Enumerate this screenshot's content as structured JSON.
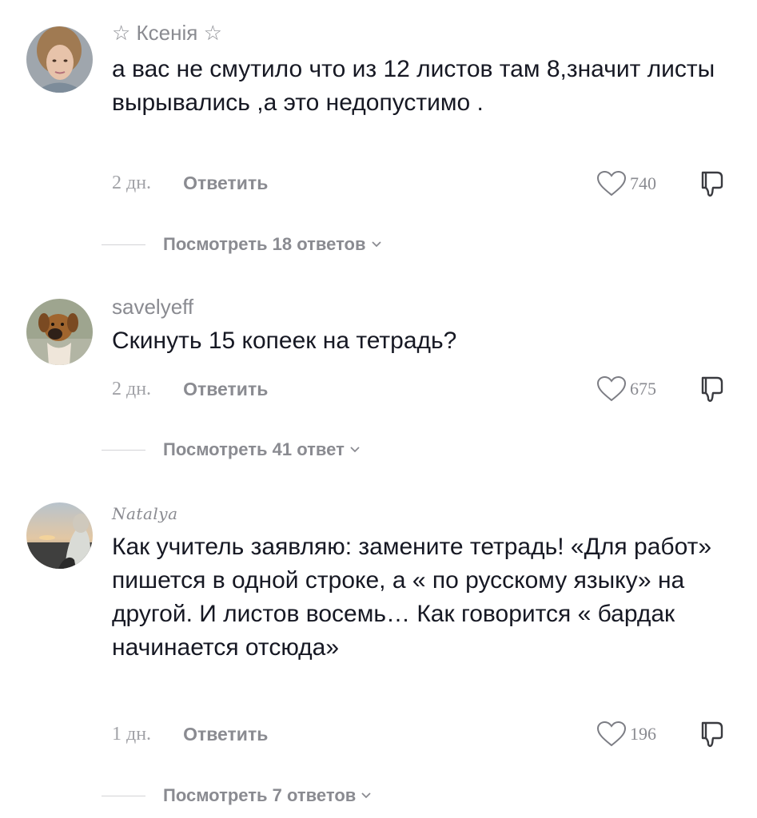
{
  "comments": [
    {
      "username": "☆ Ксенія ☆",
      "text": "а вас не смутило что из 12 листов там 8,значит листы вырывались ,а это недопустимо .",
      "age": "2 дн.",
      "reply_label": "Ответить",
      "likes": "740",
      "view_replies": "Посмотреть 18 ответов"
    },
    {
      "username": "savelyeff",
      "text": "Скинуть 15 копеек на тетрадь?",
      "age": "2 дн.",
      "reply_label": "Ответить",
      "likes": "675",
      "view_replies": "Посмотреть 41 ответ"
    },
    {
      "username": "Natalya",
      "text": "Как учитель заявляю: замените тетрадь! «Для работ» пишется в одной строке, а « по русскому языку» на другой. И листов восемь… Как говорится « бардак начинается отсюда»",
      "age": "1 дн.",
      "reply_label": "Ответить",
      "likes": "196",
      "view_replies": "Посмотреть 7 ответов"
    }
  ],
  "icons": {
    "like": "heart-outline-icon",
    "dislike": "thumbs-down-icon",
    "expand": "chevron-down-icon"
  },
  "colors": {
    "text": "#161823",
    "secondary": "#8a8b91",
    "muted": "#a1a2a7",
    "divider": "#d3d3d6"
  }
}
